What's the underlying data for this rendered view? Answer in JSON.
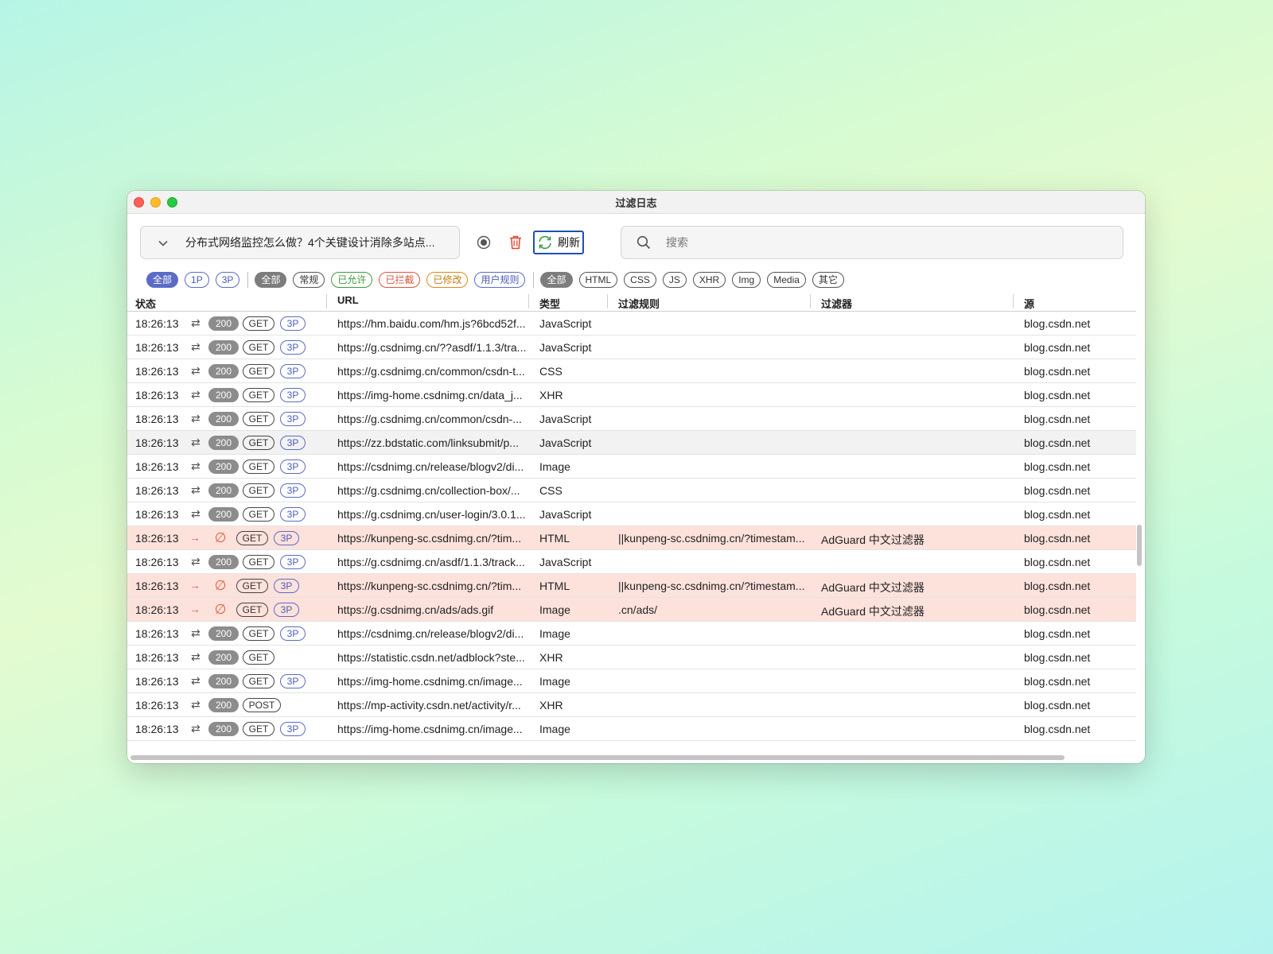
{
  "window": {
    "title": "过滤日志"
  },
  "toolbar": {
    "tab_selector_text": "分布式网络监控怎么做？4个关键设计消除多站点...",
    "refresh_label": "刷新",
    "search_placeholder": "搜索"
  },
  "filters": {
    "party": [
      "全部",
      "1P",
      "3P"
    ],
    "status": [
      "全部",
      "常规",
      "已允许",
      "已拦截",
      "已修改",
      "用户规则"
    ],
    "types": [
      "全部",
      "HTML",
      "CSS",
      "JS",
      "XHR",
      "Img",
      "Media",
      "其它"
    ]
  },
  "columns": {
    "status": "状态",
    "url": "URL",
    "type": "类型",
    "rule": "过滤规则",
    "filter": "过滤器",
    "source": "源"
  },
  "rows": [
    {
      "time": "18:26:13",
      "status": "200",
      "method": "GET",
      "party": "3P",
      "url": "https://hm.baidu.com/hm.js?6bcd52f...",
      "type": "JavaScript",
      "rule": "",
      "filter": "",
      "source": "blog.csdn.net"
    },
    {
      "time": "18:26:13",
      "status": "200",
      "method": "GET",
      "party": "3P",
      "url": "https://g.csdnimg.cn/??asdf/1.1.3/tra...",
      "type": "JavaScript",
      "rule": "",
      "filter": "",
      "source": "blog.csdn.net"
    },
    {
      "time": "18:26:13",
      "status": "200",
      "method": "GET",
      "party": "3P",
      "url": "https://g.csdnimg.cn/common/csdn-t...",
      "type": "CSS",
      "rule": "",
      "filter": "",
      "source": "blog.csdn.net"
    },
    {
      "time": "18:26:13",
      "status": "200",
      "method": "GET",
      "party": "3P",
      "url": "https://img-home.csdnimg.cn/data_j...",
      "type": "XHR",
      "rule": "",
      "filter": "",
      "source": "blog.csdn.net"
    },
    {
      "time": "18:26:13",
      "status": "200",
      "method": "GET",
      "party": "3P",
      "url": "https://g.csdnimg.cn/common/csdn-...",
      "type": "JavaScript",
      "rule": "",
      "filter": "",
      "source": "blog.csdn.net"
    },
    {
      "time": "18:26:13",
      "status": "200",
      "method": "GET",
      "party": "3P",
      "url": "https://zz.bdstatic.com/linksubmit/p...",
      "type": "JavaScript",
      "rule": "",
      "filter": "",
      "source": "blog.csdn.net"
    },
    {
      "time": "18:26:13",
      "status": "200",
      "method": "GET",
      "party": "3P",
      "url": "https://csdnimg.cn/release/blogv2/di...",
      "type": "Image",
      "rule": "",
      "filter": "",
      "source": "blog.csdn.net"
    },
    {
      "time": "18:26:13",
      "status": "200",
      "method": "GET",
      "party": "3P",
      "url": "https://g.csdnimg.cn/collection-box/...",
      "type": "CSS",
      "rule": "",
      "filter": "",
      "source": "blog.csdn.net"
    },
    {
      "time": "18:26:13",
      "status": "200",
      "method": "GET",
      "party": "3P",
      "url": "https://g.csdnimg.cn/user-login/3.0.1...",
      "type": "JavaScript",
      "rule": "",
      "filter": "",
      "source": "blog.csdn.net"
    },
    {
      "time": "18:26:13",
      "status": "",
      "method": "GET",
      "party": "3P",
      "url": "https://kunpeng-sc.csdnimg.cn/?tim...",
      "type": "HTML",
      "rule": "||kunpeng-sc.csdnimg.cn/?timestam...",
      "filter": "AdGuard 中文过滤器",
      "source": "blog.csdn.net"
    },
    {
      "time": "18:26:13",
      "status": "200",
      "method": "GET",
      "party": "3P",
      "url": "https://g.csdnimg.cn/asdf/1.1.3/track...",
      "type": "JavaScript",
      "rule": "",
      "filter": "",
      "source": "blog.csdn.net"
    },
    {
      "time": "18:26:13",
      "status": "",
      "method": "GET",
      "party": "3P",
      "url": "https://kunpeng-sc.csdnimg.cn/?tim...",
      "type": "HTML",
      "rule": "||kunpeng-sc.csdnimg.cn/?timestam...",
      "filter": "AdGuard 中文过滤器",
      "source": "blog.csdn.net"
    },
    {
      "time": "18:26:13",
      "status": "",
      "method": "GET",
      "party": "3P",
      "url": "https://g.csdnimg.cn/ads/ads.gif",
      "type": "Image",
      "rule": ".cn/ads/",
      "filter": "AdGuard 中文过滤器",
      "source": "blog.csdn.net"
    },
    {
      "time": "18:26:13",
      "status": "200",
      "method": "GET",
      "party": "3P",
      "url": "https://csdnimg.cn/release/blogv2/di...",
      "type": "Image",
      "rule": "",
      "filter": "",
      "source": "blog.csdn.net"
    },
    {
      "time": "18:26:13",
      "status": "200",
      "method": "GET",
      "party": "",
      "url": "https://statistic.csdn.net/adblock?ste...",
      "type": "XHR",
      "rule": "",
      "filter": "",
      "source": "blog.csdn.net"
    },
    {
      "time": "18:26:13",
      "status": "200",
      "method": "GET",
      "party": "3P",
      "url": "https://img-home.csdnimg.cn/image...",
      "type": "Image",
      "rule": "",
      "filter": "",
      "source": "blog.csdn.net"
    },
    {
      "time": "18:26:13",
      "status": "200",
      "method": "POST",
      "party": "",
      "url": "https://mp-activity.csdn.net/activity/r...",
      "type": "XHR",
      "rule": "",
      "filter": "",
      "source": "blog.csdn.net"
    },
    {
      "time": "18:26:13",
      "status": "200",
      "method": "GET",
      "party": "3P",
      "url": "https://img-home.csdnimg.cn/image...",
      "type": "Image",
      "rule": "",
      "filter": "",
      "source": "blog.csdn.net"
    }
  ],
  "icons": {
    "chevron": "chevron-down-icon",
    "record": "record-icon",
    "trash": "trash-icon",
    "refresh": "refresh-icon",
    "search": "search-icon",
    "transfer": "transfer-arrows-icon",
    "blocked": "blocked-icon",
    "redirect": "arrow-right-icon"
  },
  "colors": {
    "accent": "#5b6bc6",
    "blocked_row": "#fde2dc",
    "blocked_icon": "#e35b3c",
    "trash": "#e0442e",
    "refresh_border": "#1f4fb5",
    "allowed": "#3d9c3d",
    "modified": "#d98a1a"
  }
}
